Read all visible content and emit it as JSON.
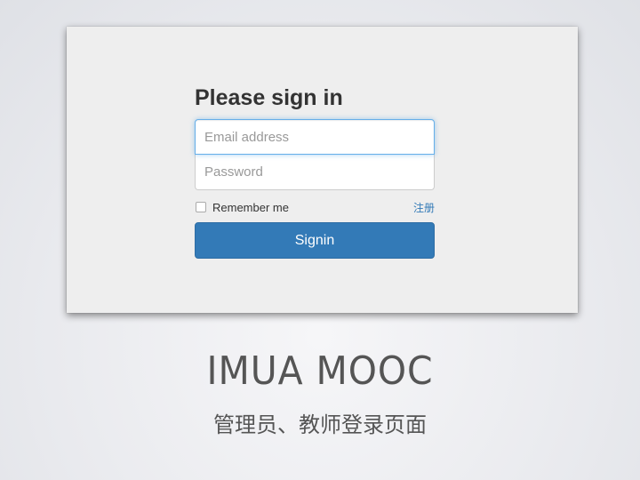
{
  "login": {
    "heading": "Please sign in",
    "email_placeholder": "Email address",
    "password_placeholder": "Password",
    "remember_label": "Remember me",
    "register_link": "注册",
    "signin_button": "Signin"
  },
  "slide": {
    "title": "IMUA MOOC",
    "subtitle": "管理员、教师登录页面"
  },
  "colors": {
    "primary": "#337ab7",
    "focus_border": "#66afe9",
    "card_background": "#eeeeee"
  }
}
